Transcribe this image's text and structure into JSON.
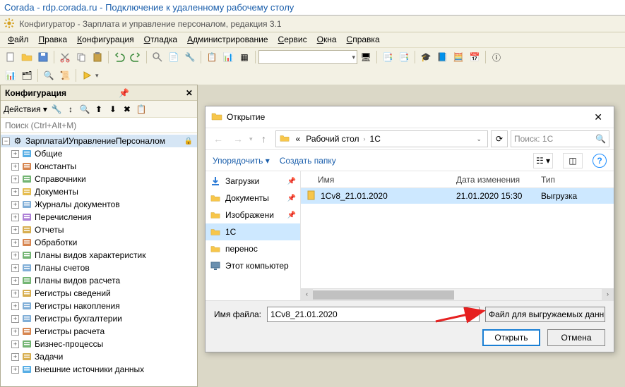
{
  "rdp_title": "Corada - rdp.corada.ru - Подключение к удаленному рабочему столу",
  "app_title": "Конфигуратор - Зарплата и управление персоналом, редакция 3.1",
  "menu": [
    "Файл",
    "Правка",
    "Конфигурация",
    "Отладка",
    "Администрирование",
    "Сервис",
    "Окна",
    "Справка"
  ],
  "cfg": {
    "title": "Конфигурация",
    "actions_label": "Действия ▾",
    "search_placeholder": "Поиск (Ctrl+Alt+M)",
    "root": "ЗарплатаИУправлениеПерсоналом",
    "items": [
      {
        "label": "Общие",
        "icon": "globe"
      },
      {
        "label": "Константы",
        "icon": "constants"
      },
      {
        "label": "Справочники",
        "icon": "catalog"
      },
      {
        "label": "Документы",
        "icon": "doc"
      },
      {
        "label": "Журналы документов",
        "icon": "journal"
      },
      {
        "label": "Перечисления",
        "icon": "enum"
      },
      {
        "label": "Отчеты",
        "icon": "report"
      },
      {
        "label": "Обработки",
        "icon": "proc"
      },
      {
        "label": "Планы видов характеристик",
        "icon": "plan"
      },
      {
        "label": "Планы счетов",
        "icon": "accounts"
      },
      {
        "label": "Планы видов расчета",
        "icon": "calcplan"
      },
      {
        "label": "Регистры сведений",
        "icon": "reginfo"
      },
      {
        "label": "Регистры накопления",
        "icon": "regacc"
      },
      {
        "label": "Регистры бухгалтерии",
        "icon": "regbuh"
      },
      {
        "label": "Регистры расчета",
        "icon": "regcalc"
      },
      {
        "label": "Бизнес-процессы",
        "icon": "bp"
      },
      {
        "label": "Задачи",
        "icon": "task"
      },
      {
        "label": "Внешние источники данных",
        "icon": "ext"
      }
    ]
  },
  "dialog": {
    "title": "Открытие",
    "breadcrumb": [
      "«",
      "Рабочий стол",
      "1C"
    ],
    "search_placeholder": "Поиск: 1C",
    "organize": "Упорядочить ▾",
    "new_folder": "Создать папку",
    "places": [
      {
        "label": "Загрузки",
        "icon": "download",
        "pinned": true
      },
      {
        "label": "Документы",
        "icon": "docs",
        "pinned": true
      },
      {
        "label": "Изображени",
        "icon": "images",
        "pinned": true
      },
      {
        "label": "1C",
        "icon": "folder",
        "selected": true
      },
      {
        "label": "перенос",
        "icon": "folder"
      },
      {
        "label": "Этот компьютер",
        "icon": "pc"
      }
    ],
    "columns": {
      "name": "Имя",
      "date": "Дата изменения",
      "type": "Тип"
    },
    "files": [
      {
        "name": "1Cv8_21.01.2020",
        "date": "21.01.2020 15:30",
        "type": "Выгрузка"
      }
    ],
    "filename_label": "Имя файла:",
    "filename_value": "1Cv8_21.01.2020",
    "filetype": "Файл для выгружаемых данн",
    "open": "Открыть",
    "cancel": "Отмена"
  }
}
